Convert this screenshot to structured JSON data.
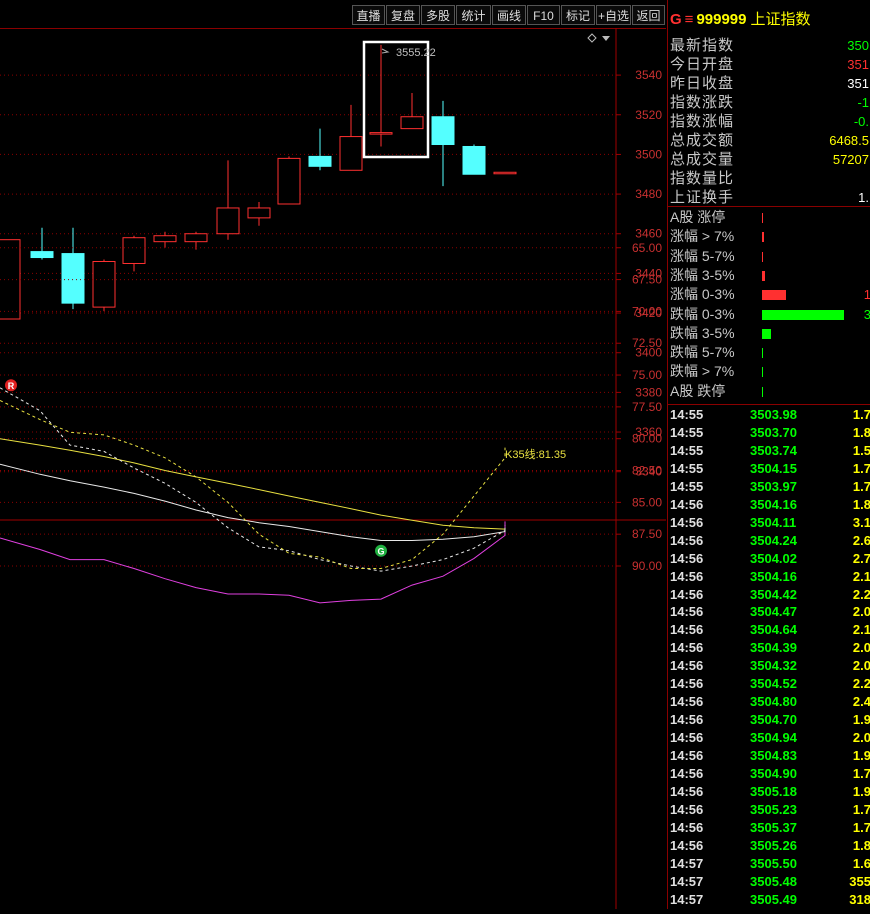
{
  "toolbar": {
    "buttons": [
      "直播",
      "复盘",
      "多股",
      "统计",
      "画线",
      "F10",
      "标记",
      "+自选",
      "返回"
    ]
  },
  "kline": {
    "y_axis_ticks": [
      "3540",
      "3520",
      "3500",
      "3480",
      "3460",
      "3440",
      "3420",
      "3400",
      "3380",
      "3360",
      "3340"
    ],
    "high_label": "3555.22",
    "candles": [
      {
        "o": 3417,
        "c": 3457,
        "h": 3457,
        "l": 3417
      },
      {
        "o": 3451,
        "c": 3448,
        "h": 3463,
        "l": 3447
      },
      {
        "o": 3450,
        "c": 3425,
        "h": 3463,
        "l": 3422
      },
      {
        "o": 3423,
        "c": 3446,
        "h": 3447,
        "l": 3421
      },
      {
        "o": 3445,
        "c": 3458,
        "h": 3459,
        "l": 3441
      },
      {
        "o": 3456,
        "c": 3459,
        "h": 3461,
        "l": 3453
      },
      {
        "o": 3456,
        "c": 3460,
        "h": 3461,
        "l": 3452
      },
      {
        "o": 3460,
        "c": 3473,
        "h": 3497,
        "l": 3457
      },
      {
        "o": 3468,
        "c": 3473,
        "h": 3476,
        "l": 3464
      },
      {
        "o": 3475,
        "c": 3498,
        "h": 3499,
        "l": 3475
      },
      {
        "o": 3499,
        "c": 3494,
        "h": 3513,
        "l": 3492
      },
      {
        "o": 3492,
        "c": 3509,
        "h": 3525,
        "l": 3492
      },
      {
        "o": 3511,
        "c": 3511,
        "h": 3555.22,
        "l": 3504
      },
      {
        "o": 3513,
        "c": 3519,
        "h": 3531,
        "l": 3513
      },
      {
        "o": 3519,
        "c": 3505,
        "h": 3527,
        "l": 3484
      },
      {
        "o": 3504,
        "c": 3490,
        "h": 3505,
        "l": 3490
      },
      {
        "o": 3491,
        "c": 3491,
        "h": 3491,
        "l": 3491
      }
    ]
  },
  "indicator": {
    "y_axis_ticks": [
      "90.00",
      "87.50",
      "85.00",
      "82.50",
      "80.00",
      "77.50",
      "75.00",
      "72.50",
      "70.00",
      "67.50",
      "65.00"
    ],
    "k35_label": "K35线:81.35",
    "r_marker": "R",
    "g_marker": "G",
    "magenta": [
      87.8,
      88.7,
      89.5,
      89.5,
      90.2,
      91.0,
      91.7,
      92.2,
      92.2,
      92.3,
      92.9,
      92.7,
      92.6,
      91.5,
      90.8,
      89.4,
      87.6,
      86.5
    ],
    "white": [
      82.0,
      82.8,
      83.3,
      83.8,
      84.3,
      84.9,
      85.6,
      86.2,
      86.6,
      86.9,
      87.3,
      87.7,
      88.0,
      88.0,
      87.9,
      87.7,
      87.3,
      87.0
    ],
    "yellow": [
      80.0,
      80.5,
      80.9,
      81.4,
      81.9,
      82.5,
      83.0,
      83.5,
      84.0,
      84.5,
      85.0,
      85.5,
      86.0,
      86.4,
      86.8,
      87.0,
      87.1,
      87.1
    ],
    "dash1": [
      76.0,
      77.8,
      80.5,
      81.0,
      82.3,
      83.5,
      85.0,
      87.0,
      88.5,
      88.8,
      89.5,
      90.0,
      90.4,
      90.0,
      89.5,
      88.6,
      87.2,
      86.8
    ],
    "dash2": [
      77.0,
      78.5,
      79.5,
      79.7,
      80.5,
      81.5,
      83.0,
      85.0,
      87.5,
      89.0,
      89.3,
      90.2,
      90.2,
      89.5,
      87.5,
      84.5,
      81.5,
      80.7
    ]
  },
  "side": {
    "g_mark": "G",
    "menu_icon": "≡",
    "code": "999999",
    "name": "上证指数",
    "stats": [
      {
        "label": "最新指数",
        "value": "350",
        "color": "#00ff00"
      },
      {
        "label": "今日开盘",
        "value": "351",
        "color": "#ff3030"
      },
      {
        "label": "昨日收盘",
        "value": "351",
        "color": "#ffffff"
      },
      {
        "label": "指数涨跌",
        "value": "-1",
        "color": "#00ff00"
      },
      {
        "label": "指数涨幅",
        "value": "-0.",
        "color": "#00ff00"
      },
      {
        "label": "总成交额",
        "value": "6468.5",
        "color": "#ffff00"
      },
      {
        "label": "总成交量",
        "value": "57207",
        "color": "#ffff00"
      },
      {
        "label": "指数量比",
        "value": "",
        "color": "#ffffff"
      },
      {
        "label": "上证换手",
        "value": "1.",
        "color": "#ffffff"
      }
    ],
    "breadth": [
      {
        "label": "A股 涨停",
        "bar": 0.0,
        "color": "#ff3030",
        "count": ""
      },
      {
        "label": "涨幅 > 7%",
        "bar": 0.03,
        "color": "#ff3030",
        "count": ""
      },
      {
        "label": "涨幅 5-7%",
        "bar": 0.01,
        "color": "#ff3030",
        "count": ""
      },
      {
        "label": "涨幅 3-5%",
        "bar": 0.04,
        "color": "#ff3030",
        "count": ""
      },
      {
        "label": "涨幅 0-3%",
        "bar": 0.29,
        "color": "#ff3030",
        "count": "1"
      },
      {
        "label": "跌幅 0-3%",
        "bar": 1.0,
        "color": "#00ff00",
        "count": "3"
      },
      {
        "label": "跌幅 3-5%",
        "bar": 0.11,
        "color": "#00ff00",
        "count": ""
      },
      {
        "label": "跌幅 5-7%",
        "bar": 0.01,
        "color": "#00ff00",
        "count": ""
      },
      {
        "label": "跌幅 > 7%",
        "bar": 0.01,
        "color": "#00ff00",
        "count": ""
      },
      {
        "label": "A股 跌停",
        "bar": 0.01,
        "color": "#00ff00",
        "count": ""
      }
    ],
    "ticks": [
      {
        "t": "14:55",
        "p": "3503.98",
        "v": "1.7"
      },
      {
        "t": "14:55",
        "p": "3503.70",
        "v": "1.8"
      },
      {
        "t": "14:55",
        "p": "3503.74",
        "v": "1.5"
      },
      {
        "t": "14:55",
        "p": "3504.15",
        "v": "1.7"
      },
      {
        "t": "14:55",
        "p": "3503.97",
        "v": "1.7"
      },
      {
        "t": "14:56",
        "p": "3504.16",
        "v": "1.8"
      },
      {
        "t": "14:56",
        "p": "3504.11",
        "v": "3.1"
      },
      {
        "t": "14:56",
        "p": "3504.24",
        "v": "2.6"
      },
      {
        "t": "14:56",
        "p": "3504.02",
        "v": "2.7"
      },
      {
        "t": "14:56",
        "p": "3504.16",
        "v": "2.1"
      },
      {
        "t": "14:56",
        "p": "3504.42",
        "v": "2.2"
      },
      {
        "t": "14:56",
        "p": "3504.47",
        "v": "2.0"
      },
      {
        "t": "14:56",
        "p": "3504.64",
        "v": "2.1"
      },
      {
        "t": "14:56",
        "p": "3504.39",
        "v": "2.0"
      },
      {
        "t": "14:56",
        "p": "3504.32",
        "v": "2.0"
      },
      {
        "t": "14:56",
        "p": "3504.52",
        "v": "2.2"
      },
      {
        "t": "14:56",
        "p": "3504.80",
        "v": "2.4"
      },
      {
        "t": "14:56",
        "p": "3504.70",
        "v": "1.9"
      },
      {
        "t": "14:56",
        "p": "3504.94",
        "v": "2.0"
      },
      {
        "t": "14:56",
        "p": "3504.83",
        "v": "1.9"
      },
      {
        "t": "14:56",
        "p": "3504.90",
        "v": "1.7"
      },
      {
        "t": "14:56",
        "p": "3505.18",
        "v": "1.9"
      },
      {
        "t": "14:56",
        "p": "3505.23",
        "v": "1.7"
      },
      {
        "t": "14:56",
        "p": "3505.37",
        "v": "1.7"
      },
      {
        "t": "14:56",
        "p": "3505.26",
        "v": "1.8"
      },
      {
        "t": "14:57",
        "p": "3505.50",
        "v": "1.6"
      },
      {
        "t": "14:57",
        "p": "3505.48",
        "v": "355"
      },
      {
        "t": "14:57",
        "p": "3505.49",
        "v": "318"
      }
    ]
  }
}
